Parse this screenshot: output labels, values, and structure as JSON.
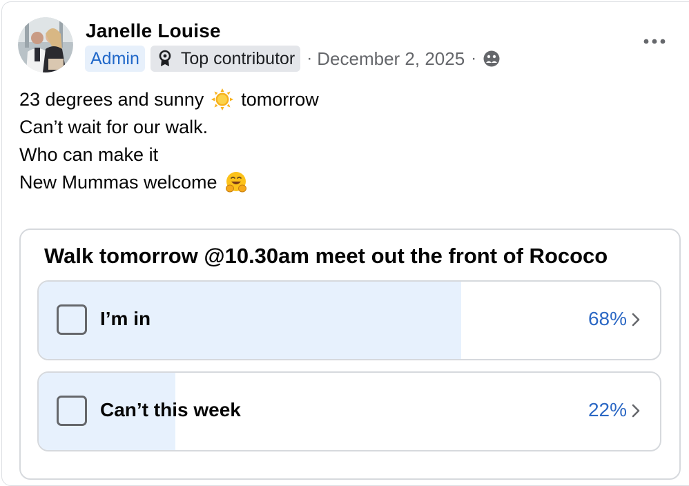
{
  "post": {
    "author": "Janelle Louise",
    "badges": {
      "admin": "Admin",
      "top_contributor": "Top contributor"
    },
    "separator": "·",
    "date": "December 2, 2025",
    "icons": {
      "more": "more-options-icon",
      "privacy": "group-privacy-icon",
      "contributor": "top-contributor-icon"
    },
    "lines": [
      {
        "before": "23 degrees and sunny",
        "emoji": "sun-emoji",
        "after": "tomorrow"
      },
      {
        "before": "Can’t wait for our walk."
      },
      {
        "before": "Who can make it"
      },
      {
        "before": "New Mummas welcome",
        "emoji": "hugging-face-emoji"
      }
    ]
  },
  "poll": {
    "question": "Walk tomorrow @10.30am meet out the front of Rococo",
    "options": [
      {
        "label": "I’m in",
        "percent_label": "68%",
        "percent": 68
      },
      {
        "label": "Can’t this week",
        "percent_label": "22%",
        "percent": 22
      }
    ]
  },
  "colors": {
    "accent_blue": "#2c68c4",
    "admin_badge_bg": "#e7f0fb",
    "poll_fill": "#e7f1fd",
    "muted_text": "#65676b"
  }
}
